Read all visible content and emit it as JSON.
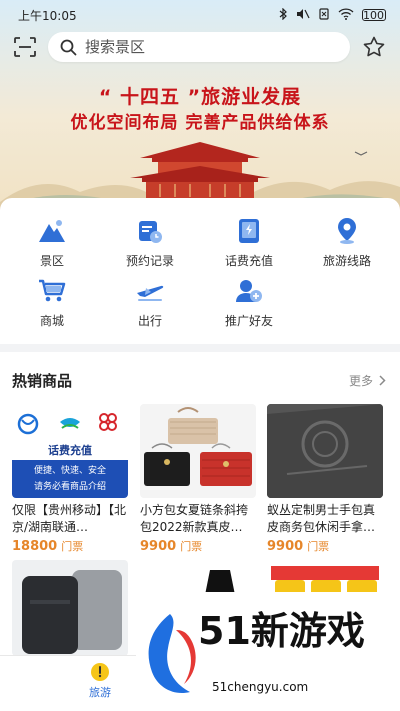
{
  "status": {
    "time": "上午10:05",
    "battery": "100"
  },
  "search": {
    "placeholder": "搜索景区"
  },
  "banner": {
    "line1": "“ 十四五 ”旅游业发展",
    "line2": "优化空间布局 完善产品供给体系"
  },
  "categories": [
    {
      "label": "景区",
      "icon": "mountain-icon"
    },
    {
      "label": "预约记录",
      "icon": "calendar-icon"
    },
    {
      "label": "话费充值",
      "icon": "phone-charge-icon"
    },
    {
      "label": "旅游线路",
      "icon": "location-pin-icon"
    },
    {
      "label": "商城",
      "icon": "cart-icon"
    },
    {
      "label": "出行",
      "icon": "airplane-icon"
    },
    {
      "label": "推广好友",
      "icon": "add-friend-icon"
    }
  ],
  "hot": {
    "title": "热销商品",
    "more": "更多",
    "products": [
      {
        "name": "仅限【贵州移动】【北京/湖南联通…",
        "price": "18800",
        "unit": "门票",
        "image": {
          "title": "话费充值",
          "sub1": "便捷、快速、安全",
          "sub2": "请务必看商品介绍"
        }
      },
      {
        "name": "小方包女夏链条斜挎包2022新款真皮…",
        "price": "9900",
        "unit": "门票"
      },
      {
        "name": "蚁丛定制男士手包真皮商务包休闲手拿…",
        "price": "9900",
        "unit": "门票"
      }
    ]
  },
  "nav": {
    "label": "旅游"
  },
  "watermark": {
    "text": "51新游戏",
    "url": "51chengyu.com"
  },
  "colors": {
    "accent": "#2f6fd6",
    "price": "#e6862a",
    "banner_red": "#c8141a"
  }
}
